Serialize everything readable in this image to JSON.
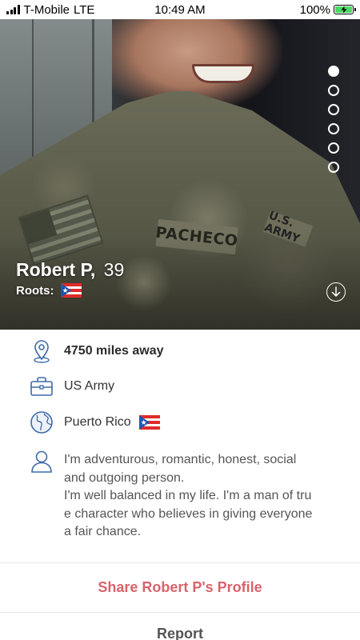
{
  "status_bar": {
    "carrier": "T-Mobile",
    "network": "LTE",
    "time": "10:49 AM",
    "battery": "100%"
  },
  "photo": {
    "name_tape": "PACHECO",
    "army_tape": "U.S. ARMY",
    "page_count": 6,
    "active_page": 1
  },
  "profile": {
    "name": "Robert P,",
    "age": "39",
    "roots_label": "Roots:",
    "roots_flag": "puerto-rico-flag"
  },
  "details": {
    "distance": "4750 miles away",
    "occupation": "US Army",
    "location": "Puerto Rico",
    "bio": "I'm adventurous, romantic, honest, social\nand outgoing person.\nI'm well balanced in my life. I'm a man of tru\ne character who believes in giving everyone\n a fair chance."
  },
  "actions": {
    "share_label": "Share Robert P's Profile",
    "report_label": "Report"
  },
  "colors": {
    "accent": "#d9636b",
    "icon_blue": "#3d6aa8",
    "battery_green": "#4cd964"
  }
}
